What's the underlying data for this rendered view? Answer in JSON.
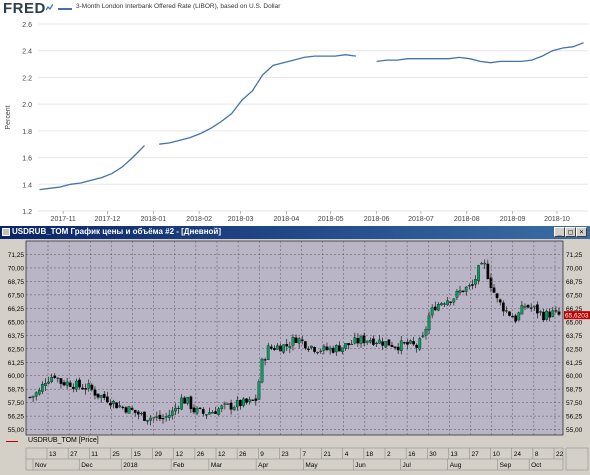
{
  "fred": {
    "logo": "FRED",
    "series_name": "3-Month London Interbank Offered Rate (LIBOR), based on U.S. Dollar",
    "ylabel": "Percent",
    "line_color": "#4572a7"
  },
  "terminal": {
    "title": "USDRUB_TOM График цены и объёма #2 - [Дневной]",
    "win_buttons": [
      "_",
      "□",
      "×"
    ],
    "legend": "USDRUB_TOM [Price]",
    "last_price": "65,6203",
    "colors": {
      "titlebar": "#0a246a",
      "plot_bg": "#b9b5c6",
      "candle_up": "#00a060",
      "candle_down": "#000000",
      "price_marker": "#c00000"
    }
  },
  "chart_data": [
    {
      "type": "line",
      "title": "",
      "series": [
        {
          "name": "3-Month London Interbank Offered Rate (LIBOR), based on U.S. Dollar"
        }
      ],
      "ylabel": "Percent",
      "ylim": [
        1.2,
        2.6
      ],
      "yticks": [
        1.2,
        1.4,
        1.6,
        1.8,
        2.0,
        2.2,
        2.4,
        2.6
      ],
      "ytick_labels": [
        "1.2",
        "1.4",
        "1.6",
        "1.8",
        "2.0",
        "2.2",
        "2.4",
        "2.6"
      ],
      "xtick_labels": [
        "2017-11",
        "2017-12",
        "2018-01",
        "2018-02",
        "2018-03",
        "2018-04",
        "2018-05",
        "2018-06",
        "2018-07",
        "2018-08",
        "2018-09",
        "2018-10"
      ],
      "points": [
        [
          "2017-10-16",
          1.36
        ],
        [
          "2017-10-23",
          1.37
        ],
        [
          "2017-10-30",
          1.38
        ],
        [
          "2017-11-06",
          1.4
        ],
        [
          "2017-11-13",
          1.41
        ],
        [
          "2017-11-20",
          1.43
        ],
        [
          "2017-11-27",
          1.45
        ],
        [
          "2017-12-04",
          1.48
        ],
        [
          "2017-12-11",
          1.53
        ],
        [
          "2017-12-18",
          1.6
        ],
        [
          "2017-12-26",
          1.69
        ],
        [
          "2018-01-05",
          1.7
        ],
        [
          "2018-01-12",
          1.71
        ],
        [
          "2018-01-19",
          1.73
        ],
        [
          "2018-01-26",
          1.75
        ],
        [
          "2018-02-02",
          1.78
        ],
        [
          "2018-02-09",
          1.82
        ],
        [
          "2018-02-16",
          1.87
        ],
        [
          "2018-02-23",
          1.93
        ],
        [
          "2018-03-02",
          2.03
        ],
        [
          "2018-03-09",
          2.1
        ],
        [
          "2018-03-16",
          2.22
        ],
        [
          "2018-03-23",
          2.29
        ],
        [
          "2018-03-30",
          2.31
        ],
        [
          "2018-04-06",
          2.33
        ],
        [
          "2018-04-13",
          2.35
        ],
        [
          "2018-04-20",
          2.36
        ],
        [
          "2018-04-27",
          2.36
        ],
        [
          "2018-05-04",
          2.36
        ],
        [
          "2018-05-11",
          2.37
        ],
        [
          "2018-05-18",
          2.36
        ],
        [
          "2018-05-25",
          2.35
        ],
        [
          "2018-06-01",
          2.32
        ],
        [
          "2018-06-08",
          2.33
        ],
        [
          "2018-06-15",
          2.33
        ],
        [
          "2018-06-22",
          2.34
        ],
        [
          "2018-06-29",
          2.34
        ],
        [
          "2018-07-06",
          2.34
        ],
        [
          "2018-07-13",
          2.34
        ],
        [
          "2018-07-20",
          2.34
        ],
        [
          "2018-07-27",
          2.35
        ],
        [
          "2018-08-03",
          2.34
        ],
        [
          "2018-08-10",
          2.32
        ],
        [
          "2018-08-17",
          2.31
        ],
        [
          "2018-08-24",
          2.32
        ],
        [
          "2018-08-31",
          2.32
        ],
        [
          "2018-09-07",
          2.32
        ],
        [
          "2018-09-14",
          2.33
        ],
        [
          "2018-09-21",
          2.36
        ],
        [
          "2018-09-28",
          2.4
        ],
        [
          "2018-10-05",
          2.42
        ],
        [
          "2018-10-12",
          2.43
        ],
        [
          "2018-10-19",
          2.46
        ]
      ],
      "grid": true
    },
    {
      "type": "candlestick",
      "title": "USDRUB_TOM",
      "ylim": [
        54.5,
        72.5
      ],
      "yticks": [
        55.0,
        56.25,
        57.5,
        58.75,
        60.0,
        61.25,
        62.5,
        63.75,
        65.0,
        66.25,
        67.5,
        68.75,
        70.0,
        71.25
      ],
      "ytick_labels": [
        "55,00",
        "56,25",
        "57,50",
        "58,75",
        "60,00",
        "61,25",
        "62,50",
        "63,75",
        "65,00",
        "66,25",
        "67,50",
        "68,75",
        "70,00",
        "71,25"
      ],
      "x_day_labels": [
        "13",
        "27",
        "11",
        "25",
        "15",
        "29",
        "12",
        "26",
        "12",
        "26",
        "9",
        "23",
        "7",
        "21",
        "4",
        "18",
        "2",
        "16",
        "30",
        "13",
        "27",
        "10",
        "24",
        "8",
        "22"
      ],
      "x_month_labels": [
        "Nov",
        "Dec",
        "2018",
        "Feb",
        "Mar",
        "Apr",
        "May",
        "Jun",
        "Jul",
        "Aug",
        "Sep",
        "Oct"
      ],
      "close_waypoints": [
        [
          0,
          58.0
        ],
        [
          3,
          58.5
        ],
        [
          5,
          59.6
        ],
        [
          8,
          60.1
        ],
        [
          10,
          59.4
        ],
        [
          13,
          59.3
        ],
        [
          16,
          59.0
        ],
        [
          19,
          58.9
        ],
        [
          22,
          58.2
        ],
        [
          25,
          57.9
        ],
        [
          28,
          57.3
        ],
        [
          31,
          57.0
        ],
        [
          34,
          56.6
        ],
        [
          37,
          56.2
        ],
        [
          40,
          56.1
        ],
        [
          43,
          56.0
        ],
        [
          46,
          56.6
        ],
        [
          49,
          57.8
        ],
        [
          51,
          57.6
        ],
        [
          53,
          56.8
        ],
        [
          56,
          56.5
        ],
        [
          59,
          56.7
        ],
        [
          62,
          57.0
        ],
        [
          65,
          57.2
        ],
        [
          68,
          57.4
        ],
        [
          71,
          57.5
        ],
        [
          73,
          57.8
        ],
        [
          75,
          61.2
        ],
        [
          77,
          62.5
        ],
        [
          80,
          62.7
        ],
        [
          83,
          62.8
        ],
        [
          86,
          63.5
        ],
        [
          89,
          63.0
        ],
        [
          92,
          62.6
        ],
        [
          95,
          62.4
        ],
        [
          98,
          62.5
        ],
        [
          101,
          62.7
        ],
        [
          104,
          63.0
        ],
        [
          107,
          63.3
        ],
        [
          110,
          63.4
        ],
        [
          113,
          63.2
        ],
        [
          116,
          63.0
        ],
        [
          119,
          62.8
        ],
        [
          122,
          62.9
        ],
        [
          125,
          62.7
        ],
        [
          127,
          63.4
        ],
        [
          129,
          65.5
        ],
        [
          131,
          66.5
        ],
        [
          134,
          67.0
        ],
        [
          137,
          67.3
        ],
        [
          140,
          68.0
        ],
        [
          143,
          68.3
        ],
        [
          145,
          69.8
        ],
        [
          147,
          70.2
        ],
        [
          149,
          68.5
        ],
        [
          151,
          67.0
        ],
        [
          154,
          66.0
        ],
        [
          157,
          65.3
        ],
        [
          160,
          66.5
        ],
        [
          163,
          66.2
        ],
        [
          166,
          65.6
        ],
        [
          169,
          65.8
        ],
        [
          171,
          65.62
        ]
      ]
    }
  ]
}
